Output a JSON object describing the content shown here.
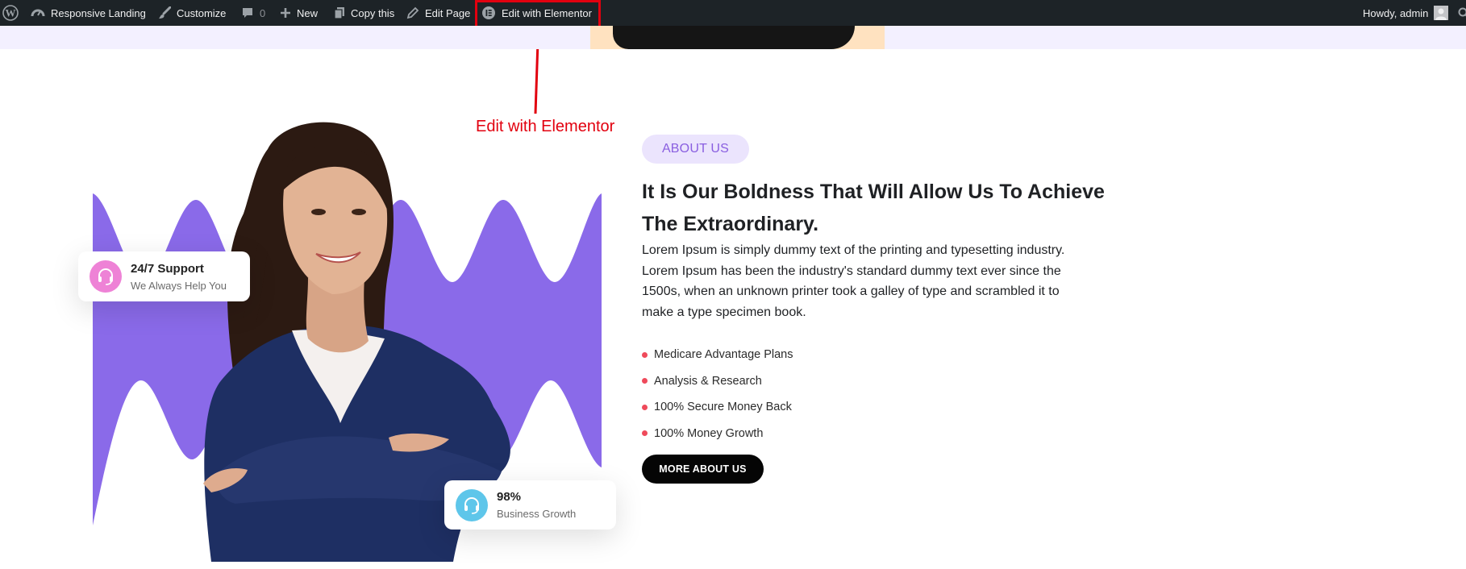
{
  "adminbar": {
    "site_name": "Responsive Landing",
    "customize": "Customize",
    "comments_count": "0",
    "new": "New",
    "copy": "Copy this",
    "edit_page": "Edit Page",
    "edit_elementor": "Edit with Elementor",
    "howdy": "Howdy, admin"
  },
  "annotation": {
    "label": "Edit with Elementor",
    "color": "#e2000f"
  },
  "support_card": {
    "title": "24/7 Support",
    "subtitle": "We Always Help You"
  },
  "growth_card": {
    "title": "98%",
    "subtitle": "Business Growth"
  },
  "about": {
    "badge": "ABOUT US",
    "heading": "It Is Our Boldness That Will Allow Us To Achieve The Extraordinary.",
    "paragraph": "Lorem Ipsum is simply dummy text of the printing and typesetting industry. Lorem Ipsum has been the industry's standard dummy text ever since the 1500s, when an unknown printer took a galley of type and scrambled it to make a type specimen book.",
    "features": [
      "Medicare Advantage Plans",
      "Analysis & Research",
      "100% Secure Money Back",
      "100% Money Growth"
    ],
    "button": "MORE ABOUT US"
  },
  "colors": {
    "accent_purple": "#8a6ae9",
    "badge_bg": "#ebe4fd",
    "bullet": "#ef4a5b",
    "adminbar_bg": "#1d2327"
  }
}
